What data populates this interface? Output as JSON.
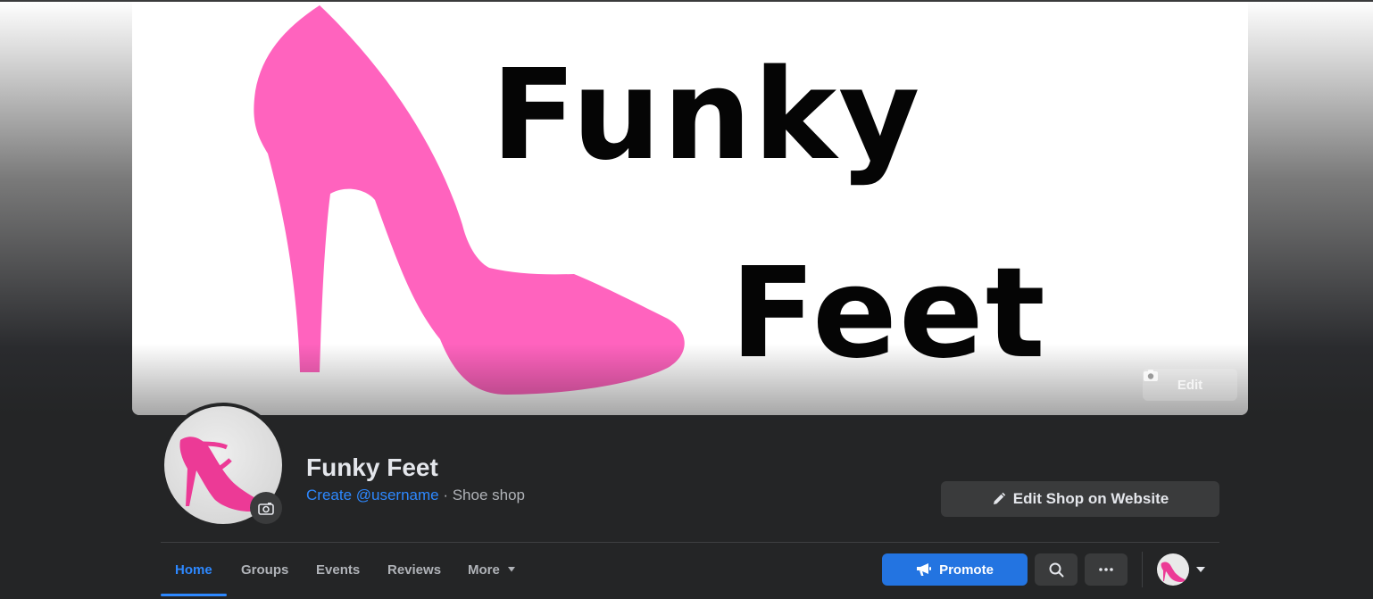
{
  "cover": {
    "logo_word_1": "Funky",
    "logo_word_2": "Feet",
    "edit_label": "Edit",
    "shoe_color": "#ff63be"
  },
  "profile": {
    "name": "Funky Feet",
    "username_link": "Create @username",
    "separator": " · ",
    "category": "Shoe shop",
    "edit_shop_label": "Edit Shop on Website"
  },
  "tabs": [
    {
      "label": "Home",
      "active": true
    },
    {
      "label": "Groups",
      "active": false
    },
    {
      "label": "Events",
      "active": false
    },
    {
      "label": "Reviews",
      "active": false
    },
    {
      "label": "More",
      "active": false
    }
  ],
  "actions": {
    "promote_label": "Promote",
    "search_icon": "search-icon",
    "more_icon": "ellipsis-icon"
  },
  "colors": {
    "accent": "#2d88ff",
    "primary_button": "#2374e1",
    "background": "#242526",
    "secondary_button": "#3a3b3c"
  }
}
